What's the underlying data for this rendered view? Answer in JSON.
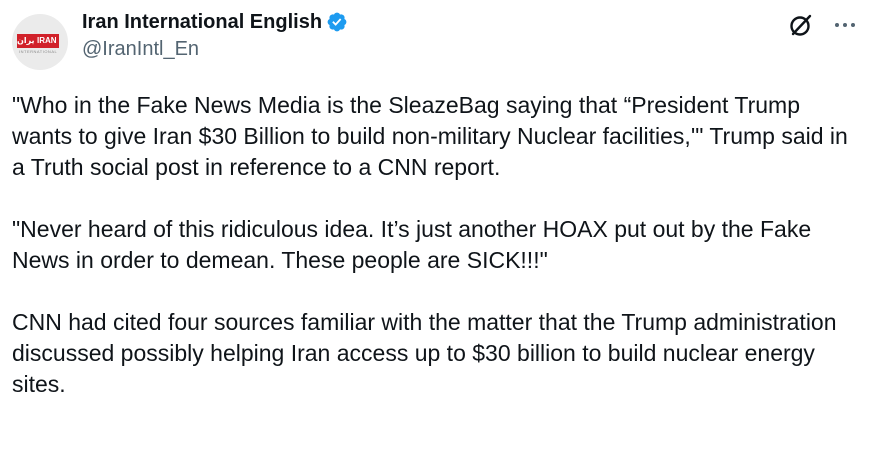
{
  "account": {
    "display_name": "Iran International English",
    "handle": "@IranIntl_En",
    "verified": true,
    "avatar": {
      "logo_left": "ایران",
      "logo_right": "IRAN",
      "logo_sub": "INTERNATIONAL"
    }
  },
  "actions": {
    "grok_icon": "grok-icon",
    "more_icon": "more-icon"
  },
  "tweet": {
    "paragraphs": [
      "\"Who in the Fake News Media is the SleazeBag saying that “President Trump wants to give Iran $30 Billion to build non-military Nuclear facilities,'\" Trump said in a Truth social post in reference to a CNN report.",
      "\"Never heard of this ridiculous idea. It’s just another HOAX put out by the Fake News in order to demean. These people are SICK!!!\"",
      "CNN had cited four sources familiar with the matter that the Trump administration discussed possibly helping Iran access up to $30 billion to build nuclear energy sites."
    ]
  },
  "colors": {
    "text": "#0f1419",
    "secondary": "#536471",
    "verified": "#1d9bf0",
    "brand_red": "#d1212a"
  }
}
